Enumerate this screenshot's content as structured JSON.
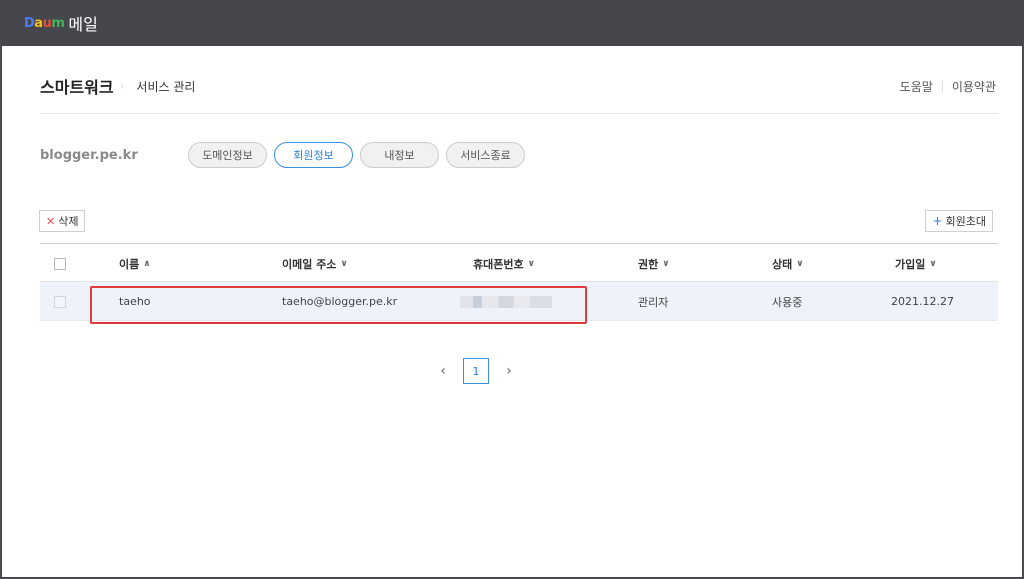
{
  "app": {
    "logo_letters": [
      "D",
      "a",
      "u",
      "m"
    ],
    "logo_suffix": "메일"
  },
  "header": {
    "brand": "스마트워크",
    "breadcrumb": "서비스 관리",
    "links": [
      "도움말",
      "이용약관"
    ]
  },
  "domain": "blogger.pe.kr",
  "tabs": [
    {
      "label": "도메인정보",
      "active": false
    },
    {
      "label": "회원정보",
      "active": true
    },
    {
      "label": "내정보",
      "active": false
    },
    {
      "label": "서비스종료",
      "active": false
    }
  ],
  "toolbar": {
    "delete_label": "삭제",
    "invite_label": "회원초대"
  },
  "table": {
    "columns": [
      "이름",
      "이메일 주소",
      "휴대폰번호",
      "권한",
      "상태",
      "가입일"
    ],
    "sort_indicators": [
      "up",
      "down",
      "down",
      "down",
      "down",
      "down"
    ],
    "rows": [
      {
        "name": "taeho",
        "email": "taeho@blogger.pe.kr",
        "phone": "",
        "role": "관리자",
        "status": "사용중",
        "joined": "2021.12.27"
      }
    ]
  },
  "pagination": {
    "current": "1"
  },
  "colors": {
    "accent": "#2a7fd9",
    "highlight_box": "#e03b3b",
    "topbar": "#46474c"
  }
}
